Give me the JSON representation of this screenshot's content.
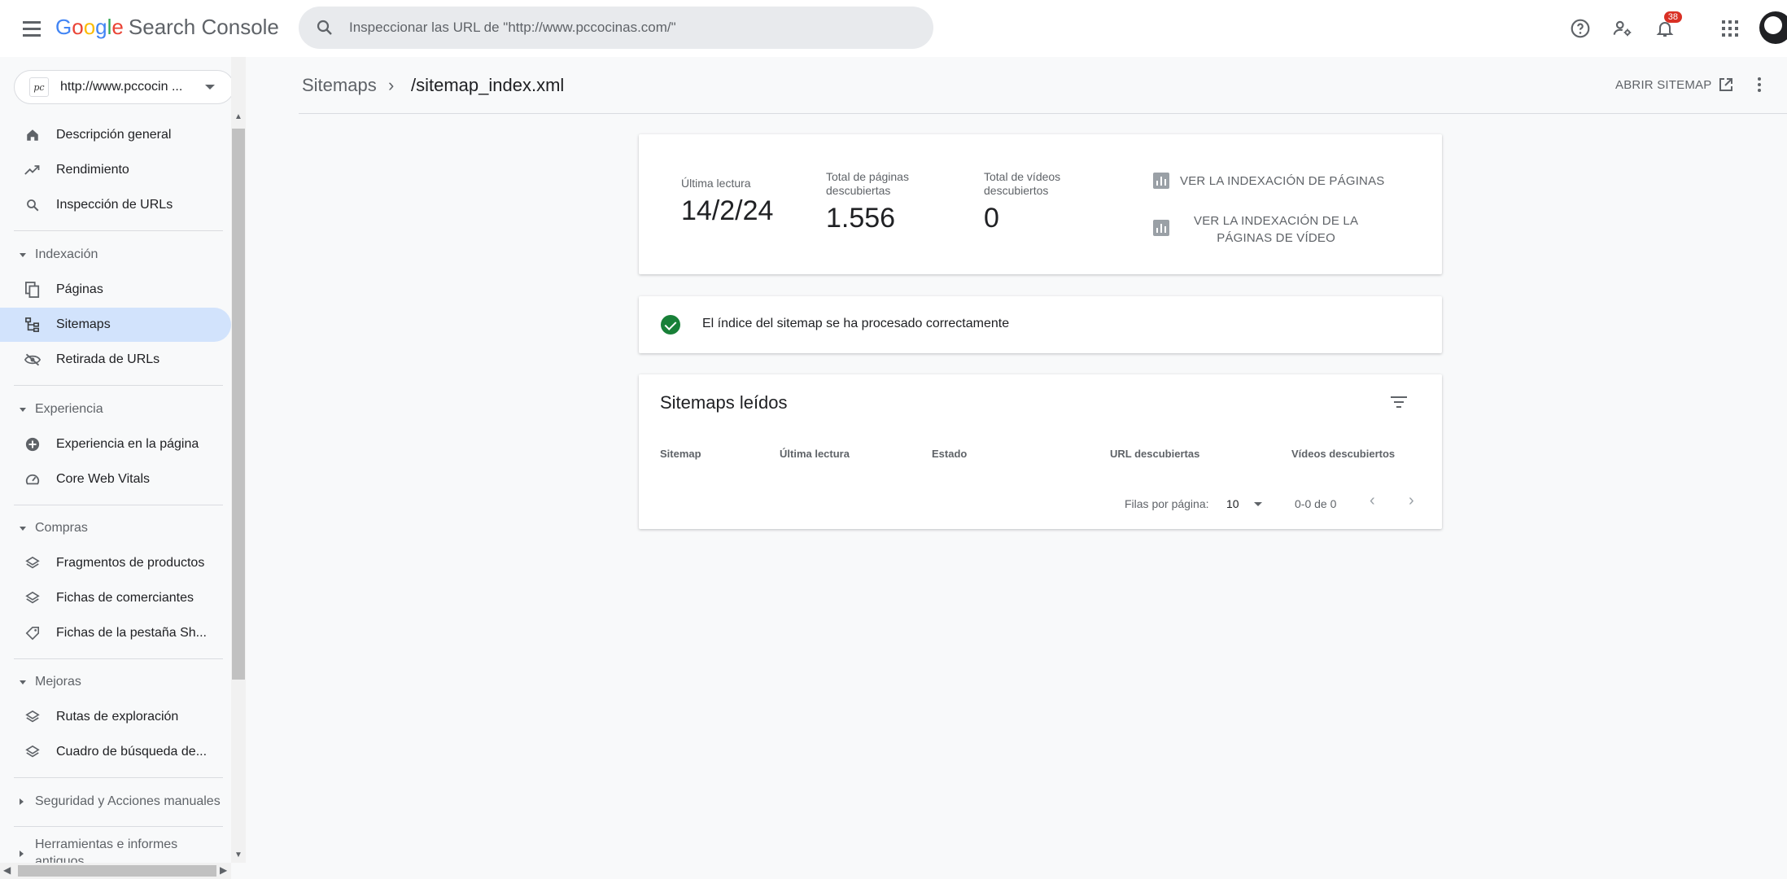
{
  "header": {
    "logo_google": [
      "G",
      "o",
      "o",
      "g",
      "l",
      "e"
    ],
    "logo_colors": [
      "#4285F4",
      "#EA4335",
      "#FBBC05",
      "#4285F4",
      "#34A853",
      "#EA4335"
    ],
    "product": "Search Console",
    "search_placeholder": "Inspeccionar las URL de \"http://www.pccocinas.com/\"",
    "notifications_count": "38",
    "icons": [
      "help-icon",
      "manage-users-icon",
      "notifications-icon",
      "apps-grid-icon"
    ]
  },
  "sidebar": {
    "property_url": "http://www.pccocin ...",
    "property_favicon": "pc",
    "items": {
      "overview": "Descripción general",
      "performance": "Rendimiento",
      "url_inspection": "Inspección de URLs",
      "indexing": "Indexación",
      "pages": "Páginas",
      "sitemaps": "Sitemaps",
      "removals": "Retirada de URLs",
      "experience": "Experiencia",
      "page_experience": "Experiencia en la página",
      "core_web_vitals": "Core Web Vitals",
      "shopping": "Compras",
      "product_snippets": "Fragmentos de productos",
      "merchant_listings": "Fichas de comerciantes",
      "shopping_tab": "Fichas de la pestaña Sh...",
      "enhancements": "Mejoras",
      "breadcrumbs": "Rutas de exploración",
      "sitelinks_searchbox": "Cuadro de búsqueda de...",
      "security": "Seguridad y Acciones manuales",
      "legacy_line1": "Herramientas e informes",
      "legacy_line2": "antiguos"
    }
  },
  "breadcrumb": {
    "parent": "Sitemaps",
    "separator": "›",
    "current": "/sitemap_index.xml",
    "open_label": "ABRIR SITEMAP"
  },
  "summary": {
    "last_read_label": "Última lectura",
    "last_read_value": "14/2/24",
    "pages_label_1": "Total de páginas",
    "pages_label_2": "descubiertas",
    "pages_value": "1.556",
    "videos_label_1": "Total de vídeos",
    "videos_label_2": "descubiertos",
    "videos_value": "0",
    "link_pages": "VER LA INDEXACIÓN DE PÁGINAS",
    "link_videos_1": "VER LA INDEXACIÓN DE LA",
    "link_videos_2": "PÁGINAS DE VÍDEO"
  },
  "status": {
    "message": "El índice del sitemap se ha procesado correctamente",
    "color": "#188038"
  },
  "table": {
    "title": "Sitemaps leídos",
    "columns": [
      "Sitemap",
      "Última lectura",
      "Estado",
      "URL descubiertas",
      "Vídeos descubiertos"
    ],
    "rows_per_page_label": "Filas por página:",
    "rows_per_page_value": "10",
    "range": "0-0 de 0",
    "prev": "‹",
    "next": "›"
  }
}
